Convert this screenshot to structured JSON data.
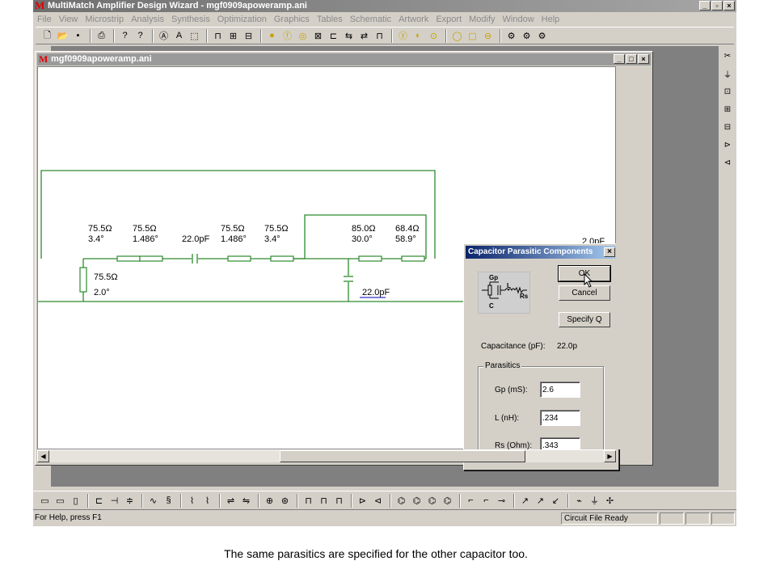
{
  "app": {
    "logo": "M",
    "title": "MultiMatch Amplifier Design Wizard - mgf0909apoweramp.ani",
    "window_buttons": [
      "_",
      "▫",
      "×"
    ]
  },
  "menu": [
    "File",
    "View",
    "Microstrip",
    "Analysis",
    "Synthesis",
    "Optimization",
    "Graphics",
    "Tables",
    "Schematic",
    "Artwork",
    "Export",
    "Modify",
    "Window",
    "Help"
  ],
  "child": {
    "logo": "M",
    "title": "mgf0909apoweramp.ani",
    "window_buttons": [
      "_",
      "□",
      "×"
    ]
  },
  "schematic": {
    "lines": [
      {
        "z": "75.5Ω",
        "angle": "3.4°"
      },
      {
        "z": "75.5Ω",
        "angle": "1.486°"
      },
      {
        "cap": "22.0pF"
      },
      {
        "z": "75.5Ω",
        "angle": "1.486°"
      },
      {
        "z": "75.5Ω",
        "angle": "3.4°"
      },
      {
        "z": "85.0Ω",
        "angle": "30.0°"
      },
      {
        "z": "68.4Ω",
        "angle": "58.9°"
      }
    ],
    "stub": {
      "z": "75.5Ω",
      "angle": "2.0°"
    },
    "shunt_cap": "22.0pF",
    "right_cap": "2.0pF"
  },
  "dialog": {
    "title": "Capacitor Parasitic Components",
    "close": "×",
    "ok": "OK",
    "cancel": "Cancel",
    "specify_q": "Specify Q",
    "picture_labels": {
      "gp": "Gp",
      "l": "L",
      "rs": "Rs",
      "c": "C"
    },
    "capacitance_label": "Capacitance (pF):",
    "capacitance_value": "22.0p",
    "group_label": "Parasitics",
    "fields": [
      {
        "label": "Gp (mS):",
        "value": "2.6"
      },
      {
        "label": "L (nH):",
        "value": ".234"
      },
      {
        "label": "Rs (Ohm):",
        "value": ".343"
      }
    ]
  },
  "status": {
    "left": "For Help, press F1",
    "right": "Circuit File Ready"
  },
  "caption": "The same parasitics are specified for the other capacitor too."
}
